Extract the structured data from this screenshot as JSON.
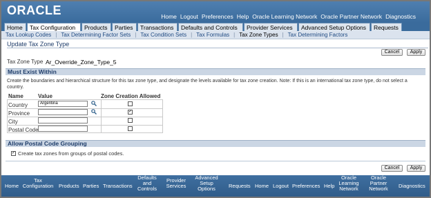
{
  "header": {
    "logo_text": "ORACLE",
    "global_links": [
      "Home",
      "Logout",
      "Preferences",
      "Help",
      "Oracle Learning Network",
      "Oracle Partner Network",
      "Diagnostics"
    ]
  },
  "tabs": [
    {
      "label": "Home"
    },
    {
      "label": "Tax Configuration"
    },
    {
      "label": "Products"
    },
    {
      "label": "Parties"
    },
    {
      "label": "Transactions"
    },
    {
      "label": "Defaults and Controls"
    },
    {
      "label": "Provider Services"
    },
    {
      "label": "Advanced Setup Options"
    },
    {
      "label": "Requests"
    }
  ],
  "subtabs": [
    {
      "label": "Tax Lookup Codes"
    },
    {
      "label": "Tax Determining Factor Sets"
    },
    {
      "label": "Tax Condition Sets"
    },
    {
      "label": "Tax Formulas"
    },
    {
      "label": "Tax Zone Types"
    },
    {
      "label": "Tax Determining Factors"
    }
  ],
  "page_title": "Update Tax Zone Type",
  "buttons": {
    "cancel": "Cancel",
    "apply": "Apply"
  },
  "tax_zone_type": {
    "label": "Tax Zone Type",
    "value": "Ar_Override_Zone_Type_5"
  },
  "must_exist": {
    "heading": "Must Exist Within",
    "instructions": "Create the boundaries and hierarchical structure for this tax zone type, and designate the levels available for tax zone creation. Note: If this is an international tax zone type, do not select a country.",
    "col_name": "Name",
    "col_value": "Value",
    "col_zone": "Zone Creation Allowed",
    "rows": [
      {
        "name": "Country",
        "value": "Argentina",
        "has_lov": true,
        "allowed": false
      },
      {
        "name": "Province",
        "value": "",
        "has_lov": true,
        "allowed": true
      },
      {
        "name": "City",
        "value": "",
        "has_lov": false,
        "allowed": false
      },
      {
        "name": "Postal Code",
        "value": "",
        "has_lov": false,
        "allowed": false
      }
    ]
  },
  "postal": {
    "heading": "Allow Postal Code Grouping",
    "checkbox_label": "Create tax zones from groups of postal codes.",
    "checked": true
  },
  "footer_links": [
    "Home",
    "Tax Configuration",
    "Products",
    "Parties",
    "Transactions",
    "Defaults and Controls",
    "Provider Services",
    "Advanced Setup Options",
    "Requests",
    "Home",
    "Logout",
    "Preferences",
    "Help",
    "Oracle Learning Network",
    "Oracle Partner Network",
    "Diagnostics"
  ],
  "colors": {
    "brand_blue": "#3a6b9c",
    "tab_bg": "#dde5ee",
    "section_bg": "#cbd6e4",
    "link": "#1f4a82"
  }
}
